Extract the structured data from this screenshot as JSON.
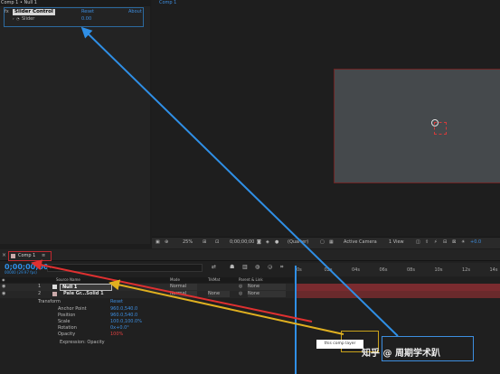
{
  "effect_controls": {
    "tab_title": "Comp 1 • Null 1",
    "effect_name": "Slider Control",
    "reset_label": "Reset",
    "about_label": "About",
    "param_name": "Slider",
    "param_value": "0.00"
  },
  "viewer": {
    "tab_label": "Comp 1",
    "zoom": "25%",
    "timecode": "0;00;00;00",
    "resolution": "(Quarter)",
    "camera": "Active Camera",
    "views": "1 View",
    "exposure": "+0.0"
  },
  "timeline": {
    "tab_label": "Comp 1",
    "timecode": "0;00;00;00",
    "frames": "00000 (29.97 fps)",
    "col_source_name": "Source Name",
    "col_mode": "Mode",
    "col_trkmat": "TrkMat",
    "col_parent": "Parent & Link",
    "layers": [
      {
        "num": "1",
        "name": "Null 1",
        "mode": "Normal",
        "trkmat": "",
        "parent": "None"
      },
      {
        "num": "2",
        "name": "Pale Gr...Solid 1",
        "mode": "Normal",
        "trkmat": "None",
        "parent": "None"
      }
    ],
    "transform_label": "Transform",
    "transform_reset": "Reset",
    "properties": [
      {
        "name": "Anchor Point",
        "value": "960.0,540.0"
      },
      {
        "name": "Position",
        "value": "960.0,540.0"
      },
      {
        "name": "Scale",
        "value": "100.0,100.0%"
      },
      {
        "name": "Rotation",
        "value": "0x+0.0°"
      },
      {
        "name": "Opacity",
        "value": "100%"
      }
    ],
    "expression_label": "Expression: Opacity",
    "ruler_ticks": [
      "0s",
      "02s",
      "04s",
      "06s",
      "08s",
      "10s",
      "12s",
      "14s"
    ],
    "tooltip": "this comp layer"
  },
  "watermark": "知乎 @ 周期学术趴",
  "colors": {
    "accent": "#2f8fe6",
    "layer_red": "#7a2b2f",
    "arrow_blue": "#2f8fe6",
    "arrow_red": "#e03030",
    "arrow_yellow": "#e0b020"
  }
}
